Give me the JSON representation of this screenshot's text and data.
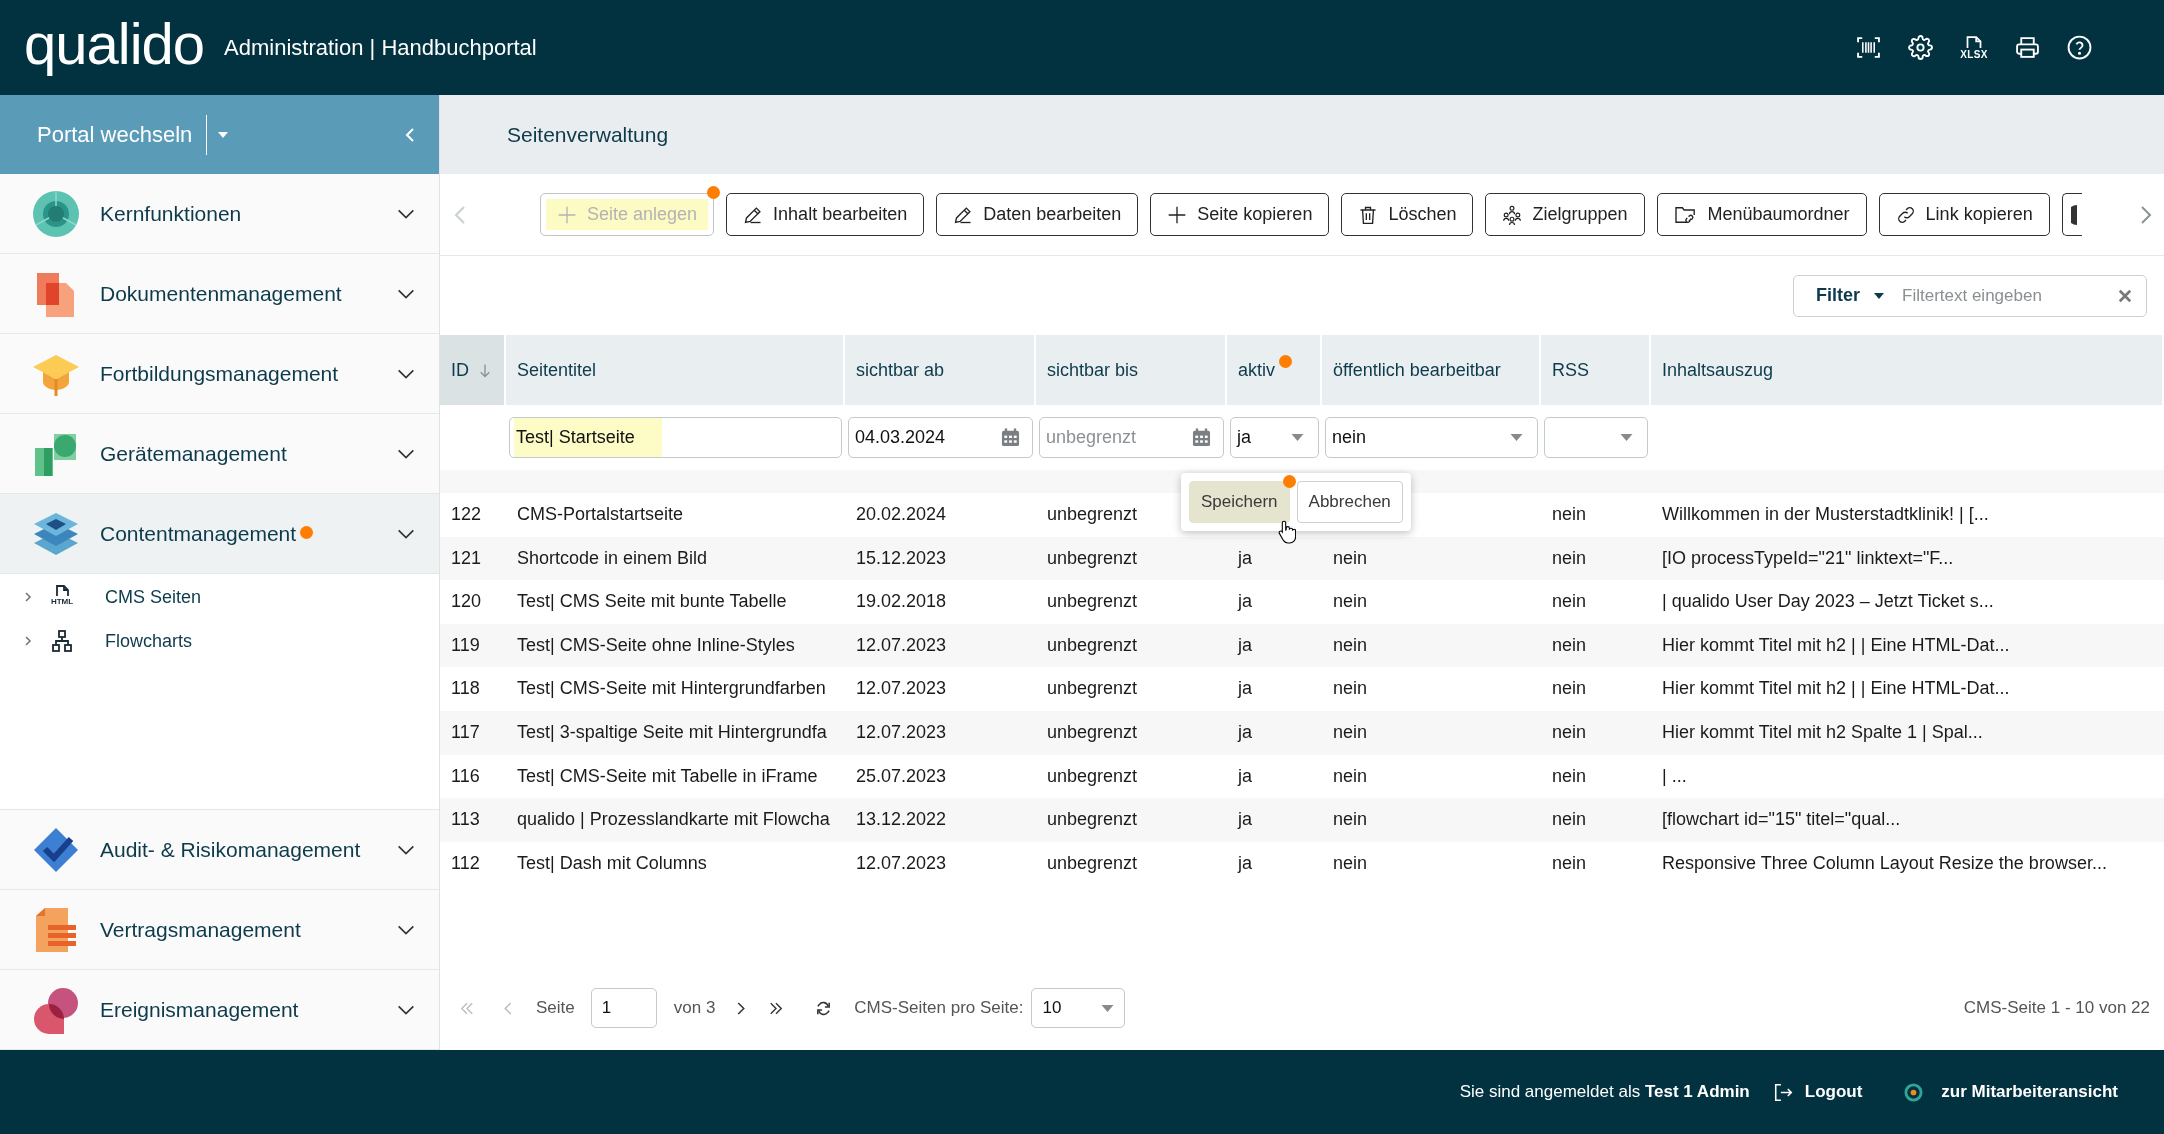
{
  "header": {
    "logo": "qualido",
    "title": "Administration | Handbuchportal",
    "export_label": "XLSX"
  },
  "sidebar": {
    "portal_switcher": "Portal wechseln",
    "modules": [
      {
        "label": "Kernfunktionen",
        "expanded": false,
        "hint": false
      },
      {
        "label": "Dokumentenmanagement",
        "expanded": false,
        "hint": false
      },
      {
        "label": "Fortbildungsmanagement",
        "expanded": false,
        "hint": false
      },
      {
        "label": "Gerätemanagement",
        "expanded": false,
        "hint": false
      },
      {
        "label": "Contentmanagement",
        "expanded": true,
        "hint": true,
        "children": [
          {
            "label": "CMS Seiten",
            "kind": "page",
            "icon_label": "HTML",
            "expanded": false
          },
          {
            "label": "Flowcharts",
            "kind": "flowchart",
            "expanded": false
          }
        ]
      },
      {
        "label": "Audit- & Risikomanagement",
        "expanded": false,
        "hint": false
      },
      {
        "label": "Vertragsmanagement",
        "expanded": false,
        "hint": false
      },
      {
        "label": "Ereignismanagement",
        "expanded": false,
        "hint": false
      }
    ]
  },
  "page": {
    "title": "Seitenverwaltung"
  },
  "toolbar": {
    "can_scroll_left": false,
    "can_scroll_right": true,
    "cut_off_button": true,
    "buttons": [
      {
        "label": "Seite anlegen",
        "disabled": true,
        "highlighted": true,
        "hint": true
      },
      {
        "label": "Inhalt bearbeiten",
        "disabled": false,
        "highlighted": false,
        "hint": false
      },
      {
        "label": "Daten bearbeiten",
        "disabled": false,
        "highlighted": false,
        "hint": false
      },
      {
        "label": "Seite kopieren",
        "disabled": false,
        "highlighted": false,
        "hint": false
      },
      {
        "label": "Löschen",
        "disabled": false,
        "highlighted": false,
        "hint": false
      },
      {
        "label": "Zielgruppen",
        "disabled": false,
        "highlighted": false,
        "hint": false
      },
      {
        "label": "Menübaumordner",
        "disabled": false,
        "highlighted": false,
        "hint": false
      },
      {
        "label": "Link kopieren",
        "disabled": false,
        "highlighted": false,
        "hint": false
      }
    ]
  },
  "filter": {
    "label": "Filter",
    "placeholder": "Filtertext eingeben"
  },
  "table": {
    "columns": [
      {
        "label": "ID",
        "sorted": true,
        "hint": false
      },
      {
        "label": "Seitentitel",
        "sorted": false,
        "hint": false,
        "filter": {
          "kind": "text",
          "value": "Test| Startseite",
          "highlighted": true
        }
      },
      {
        "label": "sichtbar ab",
        "sorted": false,
        "hint": false,
        "filter": {
          "kind": "date",
          "value": "04.03.2024"
        }
      },
      {
        "label": "sichtbar bis",
        "sorted": false,
        "hint": false,
        "filter": {
          "kind": "date",
          "placeholder": "unbegrenzt"
        }
      },
      {
        "label": "aktiv",
        "sorted": false,
        "hint": true,
        "filter": {
          "kind": "select",
          "value": "ja"
        }
      },
      {
        "label": "öffentlich bearbeitbar",
        "sorted": false,
        "hint": false,
        "filter": {
          "kind": "select",
          "value": "nein"
        }
      },
      {
        "label": "RSS",
        "sorted": false,
        "hint": false,
        "filter": {
          "kind": "select"
        }
      },
      {
        "label": "Inhaltsauszug",
        "sorted": false,
        "hint": false
      }
    ],
    "rows": [
      {
        "cells": [
          "122",
          "CMS-Portalstartseite",
          "20.02.2024",
          "unbegrenzt",
          null,
          null,
          "nein",
          "Willkommen in der Musterstadtklinik! | [..."
        ]
      },
      {
        "cells": [
          "121",
          "Shortcode in einem Bild",
          "15.12.2023",
          "unbegrenzt",
          "ja",
          "nein",
          "nein",
          "[IO processTypeId=\"21\" linktext=\"F..."
        ]
      },
      {
        "cells": [
          "120",
          "Test| CMS Seite mit bunte Tabelle",
          "19.02.2018",
          "unbegrenzt",
          "ja",
          "nein",
          "nein",
          "| qualido User Day 2023 – Jetzt Ticket s..."
        ]
      },
      {
        "cells": [
          "119",
          "Test| CMS-Seite ohne Inline-Styles",
          "12.07.2023",
          "unbegrenzt",
          "ja",
          "nein",
          "nein",
          "Hier kommt Titel mit h2 | | Eine HTML-Dat..."
        ]
      },
      {
        "cells": [
          "118",
          "Test| CMS-Seite mit Hintergrundfarben",
          "12.07.2023",
          "unbegrenzt",
          "ja",
          "nein",
          "nein",
          "Hier kommt Titel mit h2 | | Eine HTML-Dat..."
        ]
      },
      {
        "cells": [
          "117",
          "Test| 3-spaltige Seite mit Hintergrundfa",
          "12.07.2023",
          "unbegrenzt",
          "ja",
          "nein",
          "nein",
          "Hier kommt Titel mit h2 Spalte 1 | Spal..."
        ]
      },
      {
        "cells": [
          "116",
          "Test| CMS-Seite mit Tabelle in iFrame",
          "25.07.2023",
          "unbegrenzt",
          "ja",
          "nein",
          "nein",
          "| ..."
        ]
      },
      {
        "cells": [
          "113",
          "qualido | Prozesslandkarte mit Flowcha",
          "13.12.2022",
          "unbegrenzt",
          "ja",
          "nein",
          "nein",
          "[flowchart id=\"15\" titel=\"qual..."
        ]
      },
      {
        "cells": [
          "112",
          "Test| Dash mit Columns",
          "12.07.2023",
          "unbegrenzt",
          "ja",
          "nein",
          "nein",
          "Responsive Three Column Layout Resize the browser..."
        ]
      }
    ],
    "row_popup": {
      "buttons": [
        {
          "label": "Speichern",
          "hovered": true,
          "hint": true
        },
        {
          "label": "Abbrechen",
          "hovered": false,
          "hint": false
        }
      ]
    }
  },
  "pagination": {
    "can_go_back": false,
    "can_go_forward": true,
    "page_label": "Seite",
    "page": "1",
    "page_count": "von 3",
    "per_page_label": "CMS-Seiten pro Seite:",
    "per_page": "10",
    "summary": "CMS-Seite 1 - 10 von 22"
  },
  "footer": {
    "login_info": "Sie sind angemeldet als **Test 1 Admin**",
    "logout": "Logout",
    "employee_view": "zur Mitarbeiteransicht"
  }
}
